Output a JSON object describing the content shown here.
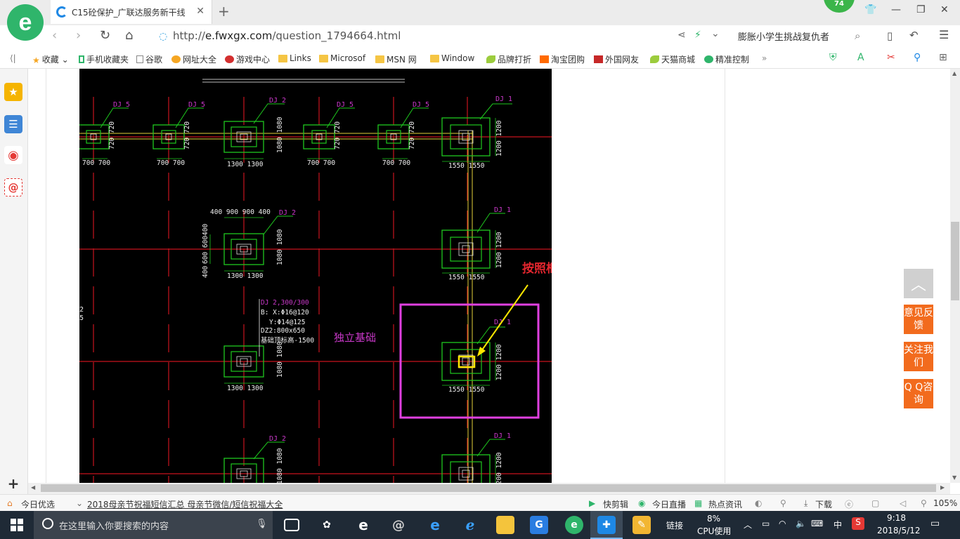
{
  "browser": {
    "tab_title": "C15砼保护_广联达服务新干线",
    "badge_count": "74",
    "url_prefix": "http://",
    "url_domain": "e.fwxgx.com",
    "url_path": "/question_1794664.html",
    "search_text": "膨胀小学生挑战复仇者"
  },
  "bookmarks": [
    {
      "label": "收藏",
      "icon": "star-icon"
    },
    {
      "label": "手机收藏夹",
      "icon": "phone-icon"
    },
    {
      "label": "谷歌",
      "icon": "page-icon"
    },
    {
      "label": "网址大全",
      "icon": "globe-icon"
    },
    {
      "label": "游戏中心",
      "icon": "game-icon"
    },
    {
      "label": "Links",
      "icon": "folder-icon"
    },
    {
      "label": "Microsof",
      "icon": "folder-icon"
    },
    {
      "label": "MSN 网",
      "icon": "folder-icon"
    },
    {
      "label": "Window",
      "icon": "folder-icon"
    },
    {
      "label": "品牌打折",
      "icon": "leaf-icon"
    },
    {
      "label": "淘宝团购",
      "icon": "taobao-icon"
    },
    {
      "label": "外国网友",
      "icon": "flag-icon"
    },
    {
      "label": "天猫商城",
      "icon": "leaf-icon"
    },
    {
      "label": "精准控制",
      "icon": "wechat-icon"
    }
  ],
  "cad": {
    "annotation": "按照框架柱的截面",
    "region_label": "独立基础",
    "foundations": {
      "dj5": "DJ 5",
      "dj2": "DJ 2",
      "dj1": "DJ 1",
      "w700": "700 700",
      "h720": "720 720",
      "w1300": "1300 1300",
      "h1080": "1080 1080",
      "w1550": "1550 1550",
      "h1200": "1200 1200",
      "dims_top": "400  900 900  400",
      "dims_left_a": "400",
      "dims_left_b": "600 600",
      "dims_left_c": "400"
    },
    "spec": {
      "line1": "DJ 2,300/300",
      "line2": "B: X:Φ16@120",
      "line3": "Y:Φ14@125",
      "line4": "DZ2:800x650",
      "line5": "基础顶标高-1500"
    },
    "side_labels": [
      "2",
      "5"
    ]
  },
  "floating": {
    "totop": "︿",
    "feedback": "意见反馈",
    "follow": "关注我们",
    "qq": "Q Q咨询"
  },
  "status": {
    "today": "今日优选",
    "news": "2018母亲节祝福短信汇总 母亲节微信/短信祝福大全",
    "kuaijian": "快剪辑",
    "live": "今日直播",
    "hot": "热点资讯",
    "download": "下载",
    "zoom": "105%"
  },
  "taskbar": {
    "search_placeholder": "在这里输入你要搜索的内容",
    "link_label": "链接",
    "cpu_pct": "8%",
    "cpu_label": "CPU使用",
    "ime": "中",
    "time": "9:18",
    "date": "2018/5/12"
  }
}
